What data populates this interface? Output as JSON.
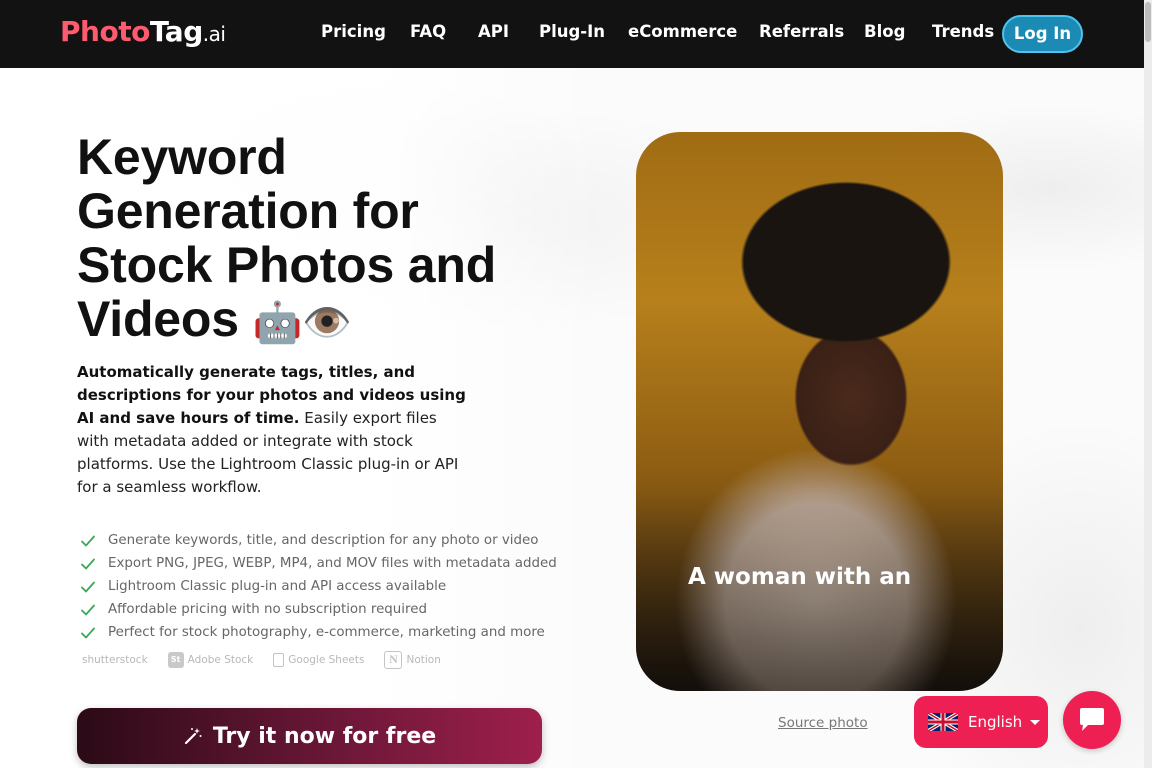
{
  "header": {
    "logo": {
      "part1": "Photo",
      "part2": "Tag",
      "part3": ".ai"
    },
    "nav": [
      {
        "label": "Pricing"
      },
      {
        "label": "FAQ"
      },
      {
        "label": "API"
      },
      {
        "label": "Plug-In"
      },
      {
        "label": "eCommerce"
      },
      {
        "label": "Referrals"
      },
      {
        "label": "Blog"
      },
      {
        "label": "Trends"
      }
    ],
    "login_label": "Log In"
  },
  "hero": {
    "title_lines": [
      "Keyword",
      "Generation for",
      "Stock Photos and",
      "Videos"
    ],
    "title_emoji": "🤖👁️",
    "desc_bold": "Automatically generate tags, titles, and descriptions for your photos and videos using AI and save hours of time.",
    "desc_rest": " Easily export files with metadata added or integrate with stock platforms. Use the Lightroom Classic plug-in or API for a seamless workflow.",
    "features": [
      "Generate keywords, title, and description for any photo or video",
      "Export PNG, JPEG, WEBP, MP4, and MOV files with metadata added",
      "Lightroom Classic plug-in and API access available",
      "Affordable pricing with no subscription required",
      "Perfect for stock photography, e-commerce, marketing and more"
    ],
    "partners": {
      "shutterstock": "shutterstock",
      "adobe_badge": "St",
      "adobe": "Adobe Stock",
      "sheets": "Google Sheets",
      "notion_badge": "N",
      "notion": "Notion"
    },
    "cta_label": "Try it now for free"
  },
  "photo": {
    "caption": "A woman with an",
    "source_label": "Source photo"
  },
  "language": {
    "label": "English"
  },
  "colors": {
    "accent": "#ee1f52",
    "logo_red": "#ff5b6f",
    "login_blue": "#1b8ab5",
    "check_green": "#3aa85a",
    "header_bg": "#121212"
  }
}
